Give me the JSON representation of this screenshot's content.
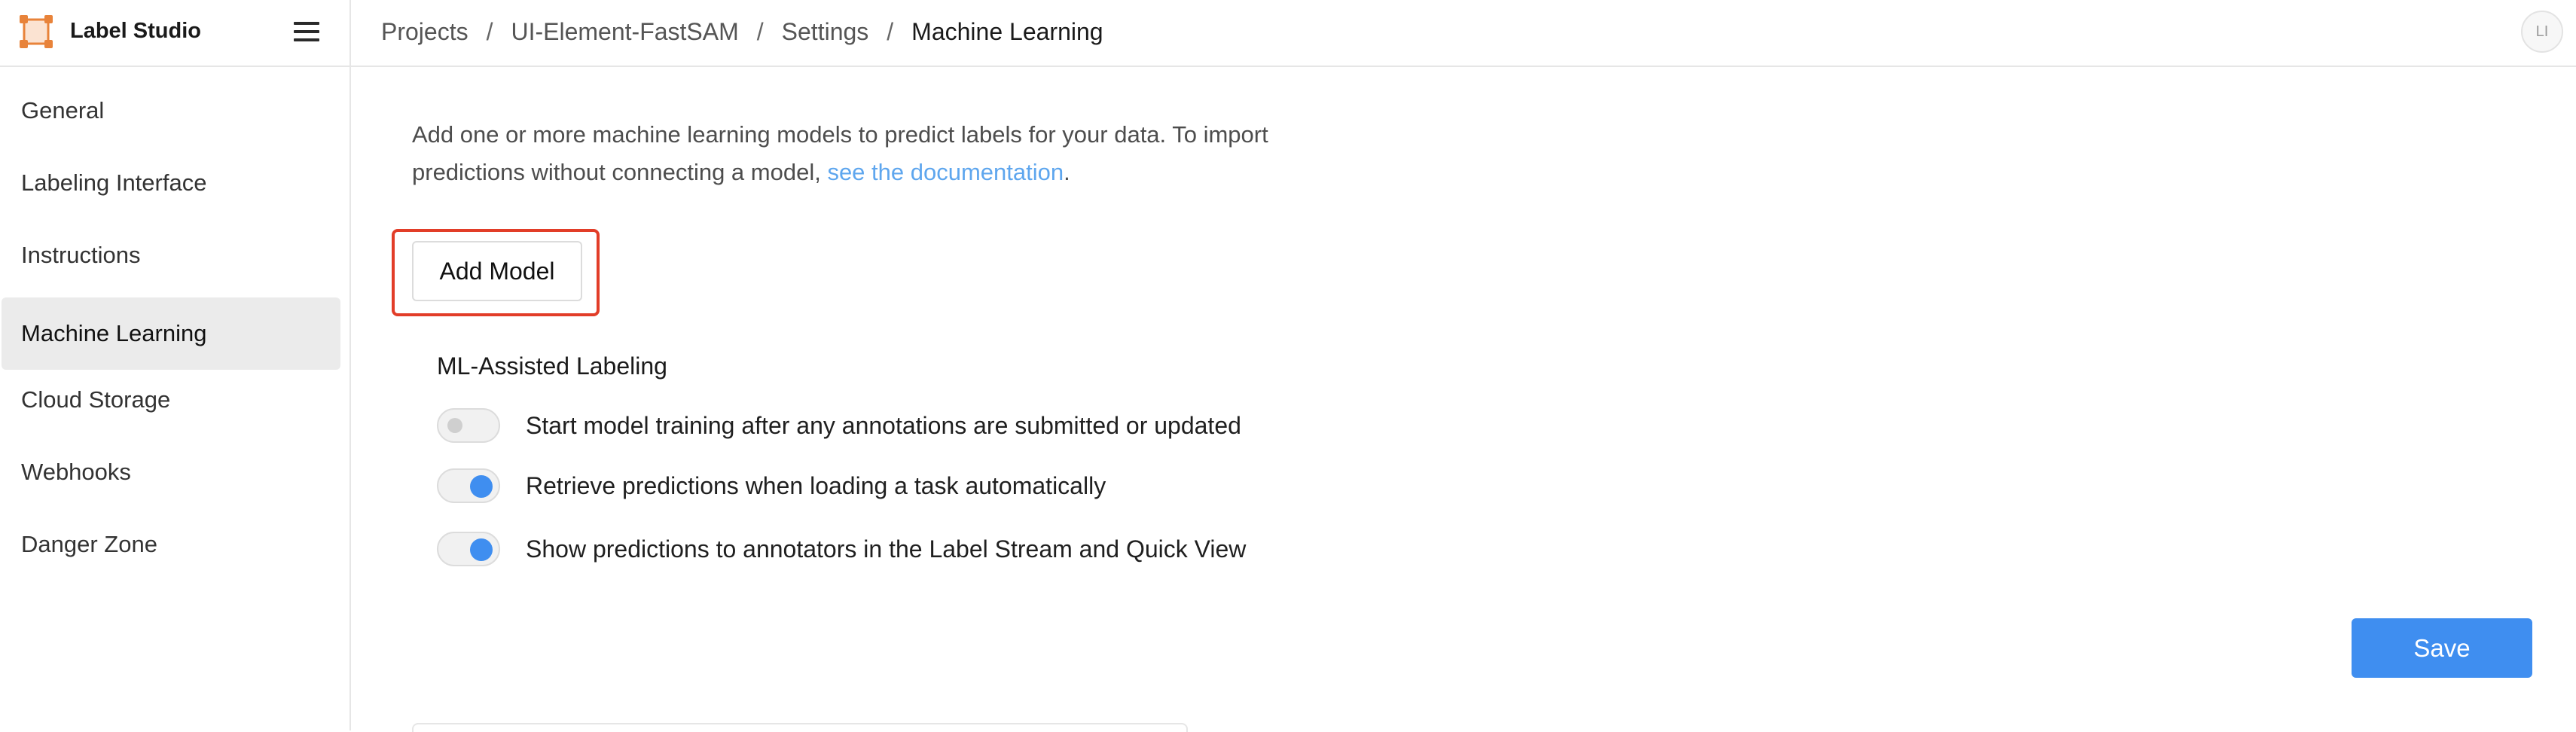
{
  "app": {
    "name": "Label Studio",
    "logo_icon": "label-studio-logo-icon",
    "menu_icon": "hamburger-menu-icon"
  },
  "breadcrumb": {
    "items": [
      "Projects",
      "UI-Element-FastSAM",
      "Settings",
      "Machine Learning"
    ],
    "separator": "/"
  },
  "user": {
    "initials": "LI"
  },
  "sidebar": {
    "items": [
      {
        "label": "General",
        "active": false
      },
      {
        "label": "Labeling Interface",
        "active": false
      },
      {
        "label": "Instructions",
        "active": false
      },
      {
        "label": "Machine Learning",
        "active": true
      },
      {
        "label": "Cloud Storage",
        "active": false
      },
      {
        "label": "Webhooks",
        "active": false
      },
      {
        "label": "Danger Zone",
        "active": false
      }
    ]
  },
  "main": {
    "intro_text_1": "Add one or more machine learning models to predict labels for your data. To import predictions without connecting a model, ",
    "intro_link": "see the documentation",
    "intro_text_2": ".",
    "add_model_label": "Add Model",
    "ml_section_title": "ML-Assisted Labeling",
    "toggles": [
      {
        "label": "Start model training after any annotations are submitted or updated",
        "enabled": false
      },
      {
        "label": "Retrieve predictions when loading a task automatically",
        "enabled": true
      },
      {
        "label": "Show predictions to annotators in the Label Stream and Quick View",
        "enabled": true
      }
    ],
    "save_label": "Save"
  },
  "colors": {
    "accent": "#3f8ef0",
    "link": "#5ea6ee",
    "highlight": "#e23d28",
    "active_sidebar_bg": "#ebebeb",
    "logo": "#e8833a"
  }
}
